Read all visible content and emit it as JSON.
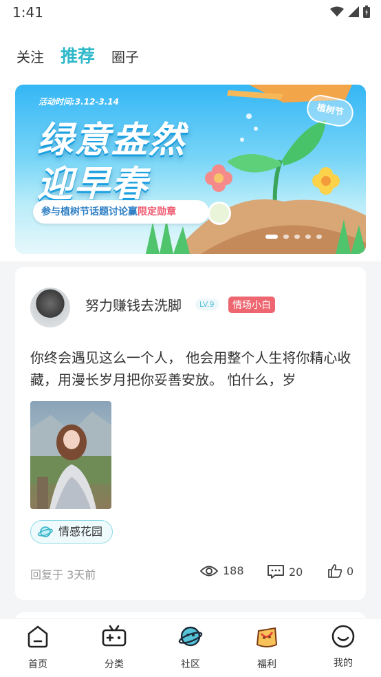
{
  "status_bar": {
    "time": "1:41"
  },
  "header": {
    "tabs": [
      {
        "label": "关注",
        "active": false
      },
      {
        "label": "推荐",
        "active": true
      },
      {
        "label": "圈子",
        "active": false
      }
    ]
  },
  "banner": {
    "date": "活动时间:3.12-3.14",
    "title_line1": "绿意盎然",
    "title_line2": "迎早春",
    "tag": "植树节",
    "pill_prefix": "参与植树节话题讨论赢",
    "pill_highlight": "限定勋章",
    "dots_total": 5,
    "dots_active": 1
  },
  "post": {
    "username": "努力赚钱去洗脚",
    "level": "LV.9",
    "title_badge": "情场小白",
    "content": "你终会遇见这么一个人， 他会用整个人生将你精心收藏，用漫长岁月把你妥善安放。 怕什么，岁",
    "circle": "情感花园",
    "reply_time": "回复于 3天前",
    "views": "188",
    "comments": "20",
    "likes": "0"
  },
  "bottom_nav": [
    {
      "label": "首页",
      "icon": "home-icon"
    },
    {
      "label": "分类",
      "icon": "gamepad-icon"
    },
    {
      "label": "社区",
      "icon": "planet-mascot-icon",
      "active": true
    },
    {
      "label": "福利",
      "icon": "gift-bag-icon"
    },
    {
      "label": "我的",
      "icon": "smile-icon"
    }
  ],
  "colors": {
    "accent": "#2eb8c9",
    "badge_red": "#ee6670",
    "muted": "#999999"
  }
}
